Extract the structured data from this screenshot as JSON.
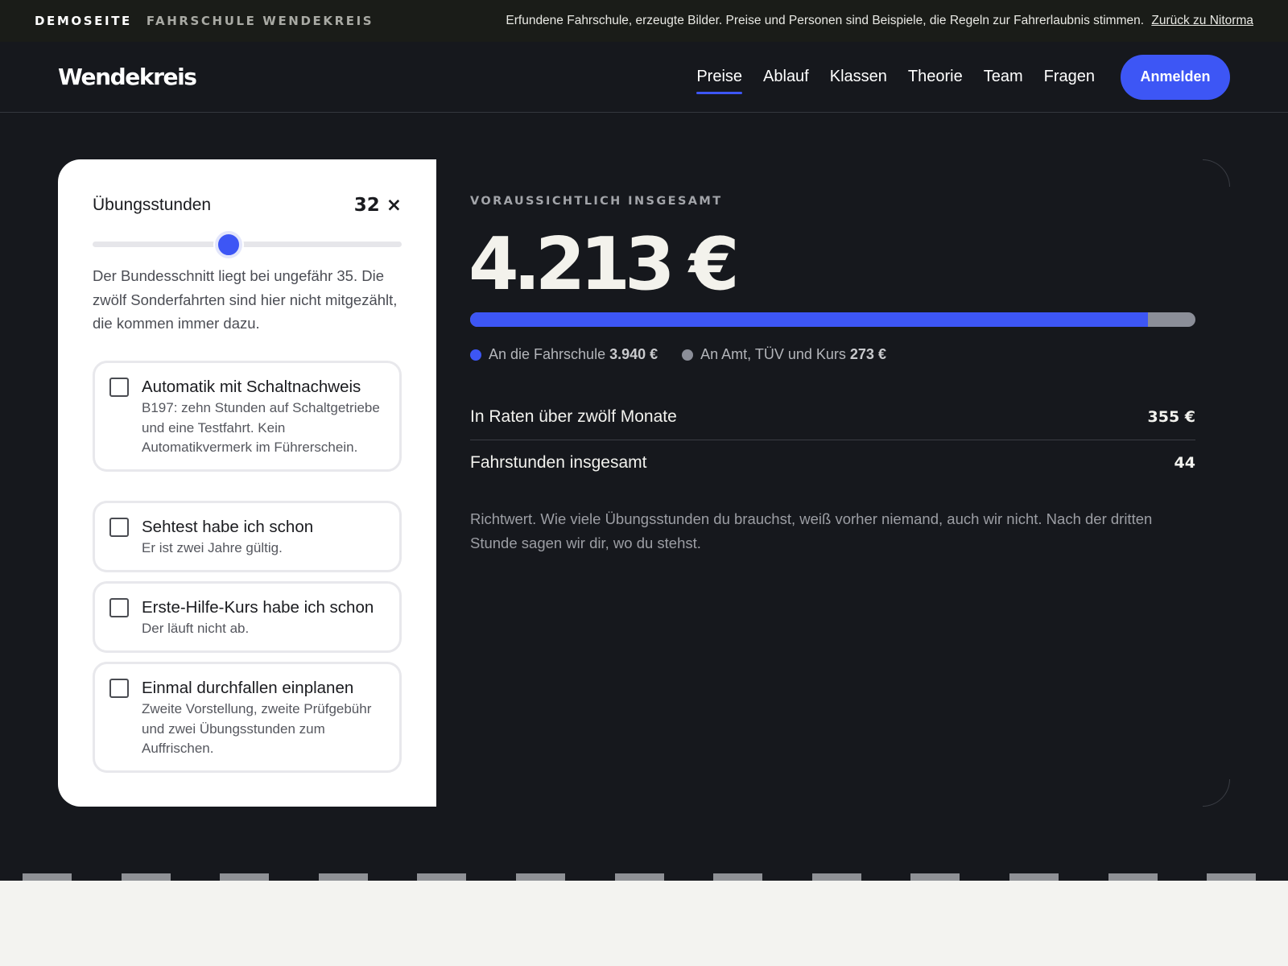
{
  "topbar": {
    "demo_label": "DEMOSEITE",
    "school_label": "FAHRSCHULE WENDEKREIS",
    "note": "Erfundene Fahrschule, erzeugte Bilder. Preise und Personen sind Beispiele, die Regeln zur Fahrerlaubnis stimmen.",
    "back_link": "Zurück zu Nitorma"
  },
  "header": {
    "logo": "Wendekreis",
    "nav": [
      {
        "label": "Preise",
        "active": true
      },
      {
        "label": "Ablauf"
      },
      {
        "label": "Klassen"
      },
      {
        "label": "Theorie"
      },
      {
        "label": "Team"
      },
      {
        "label": "Fragen"
      }
    ],
    "cta_label": "Anmelden"
  },
  "calculator": {
    "lessons_label": "Übungsstunden",
    "lessons_value": "32 ×",
    "slider_fraction": 0.44,
    "description": "Der Bundesschnitt liegt bei ungefähr 35. Die zwölf Sonderfahrten sind hier nicht mitgezählt, die kommen immer dazu.",
    "options": [
      {
        "title": "Automatik mit Schaltnachweis",
        "desc": "B197: zehn Stunden auf Schaltgetriebe und eine Testfahrt. Kein Automatikvermerk im Führerschein.",
        "checked": false
      },
      {
        "title": "Sehtest habe ich schon",
        "desc": "Er ist zwei Jahre gültig.",
        "checked": false
      },
      {
        "title": "Erste-Hilfe-Kurs habe ich schon",
        "desc": "Der läuft nicht ab.",
        "checked": false
      },
      {
        "title": "Einmal durchfallen einplanen",
        "desc": "Zweite Vorstellung, zweite Prüfgebühr und zwei Übungsstunden zum Auffrischen.",
        "checked": false
      }
    ]
  },
  "result": {
    "eyebrow": "VORAUSSICHTLICH INSGESAMT",
    "total": "4.213 €",
    "school_share_fraction": 0.935,
    "legend": [
      {
        "label": "An die Fahrschule",
        "value": "3.940 €",
        "color": "#3d56f5"
      },
      {
        "label": "An Amt, TÜV und Kurs",
        "value": "273 €",
        "color": "#8b8e98"
      }
    ],
    "stats": [
      {
        "label": "In Raten über zwölf Monate",
        "value": "355 €"
      },
      {
        "label": "Fahrstunden insgesamt",
        "value": "44"
      }
    ],
    "hint": "Richtwert. Wie viele Übungsstunden du brauchst, weiß vorher niemand, auch wir nicht. Nach der dritten Stunde sagen wir dir, wo du stehst."
  },
  "colors": {
    "accent": "#3d56f5",
    "background": "#16181d",
    "panel": "#ffffff"
  }
}
